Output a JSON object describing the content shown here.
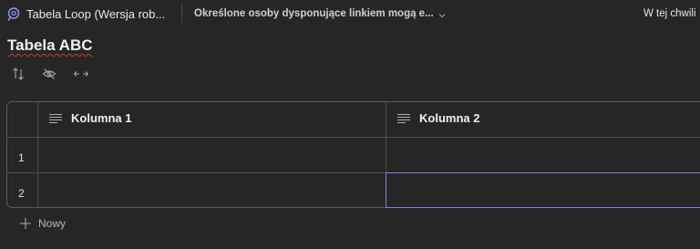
{
  "topbar": {
    "document_title": "Tabela Loop (Wersja rob...",
    "share_status": "Określone osoby dysponujące linkiem mogą e...",
    "save_status": "W tej chwili"
  },
  "page": {
    "title": "Tabela ABC"
  },
  "toolbar": {
    "icons": [
      "sort-icon",
      "hide-icon",
      "column-width-icon"
    ]
  },
  "table": {
    "columns": [
      {
        "label": "Kolumna 1",
        "icon": "text-lines-icon"
      },
      {
        "label": "Kolumna 2",
        "icon": "text-lines-icon"
      }
    ],
    "rows": [
      {
        "number": "1",
        "cells": [
          "",
          ""
        ]
      },
      {
        "number": "2",
        "cells": [
          "",
          ""
        ]
      }
    ],
    "new_row_label": "Nowy"
  },
  "colors": {
    "background": "#262626",
    "accent": "#7b83eb",
    "spellcheck": "#d13438"
  }
}
